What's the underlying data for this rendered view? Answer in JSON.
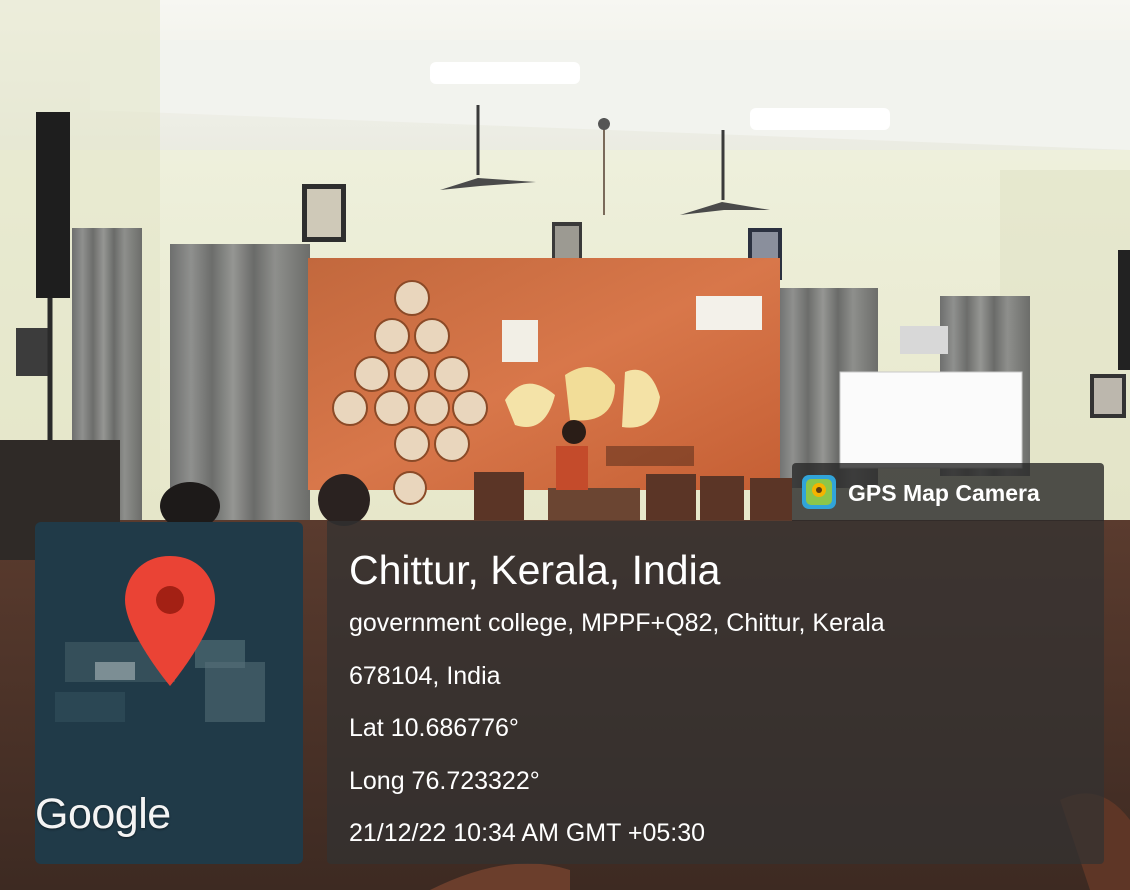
{
  "map": {
    "logo_text": "Google",
    "pin_color": "#ea4335"
  },
  "stamp": {
    "app_name": "GPS Map Camera",
    "app_icon": "gps-map-camera-icon",
    "location_title": "Chittur, Kerala, India",
    "address_line1": "government college, MPPF+Q82, Chittur, Kerala",
    "address_line2": "678104, India",
    "latitude": "Lat 10.686776°",
    "longitude": "Long 76.723322°",
    "datetime": "21/12/22 10:34 AM GMT +05:30"
  }
}
